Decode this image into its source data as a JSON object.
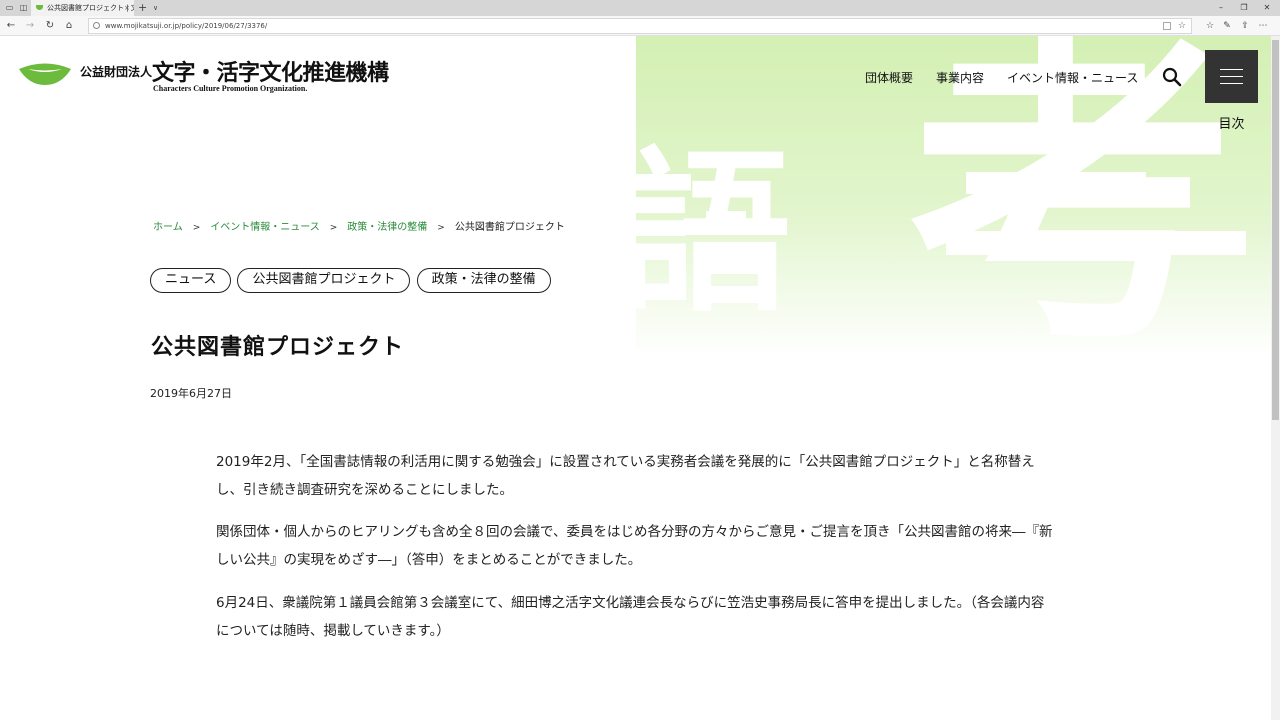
{
  "browser": {
    "tab_title": "公共図書館プロジェクト | 文",
    "tab_close": "×",
    "new_tab": "+",
    "tab_list": "∨",
    "url": "www.mojikatsuji.or.jp/policy/2019/06/27/3376/",
    "icons": [
      "tab-actions-icon",
      "back-icon",
      "forward-icon",
      "refresh-icon",
      "home-icon",
      "favorite-star-icon",
      "favorites-icon",
      "pen-icon",
      "share-icon",
      "more-icon"
    ]
  },
  "site": {
    "logo_prefix": "公益財団法人",
    "logo_title": "文字・活字文化推進機構",
    "logo_subtitle": "Characters Culture Promotion Organization.",
    "brand_color": "#6cbb3c"
  },
  "nav": {
    "items": [
      "団体概要",
      "事業内容",
      "イベント情報・ニュース"
    ],
    "menu_label": "目次"
  },
  "hero": {
    "glyph_left": "語",
    "glyph_right": "考"
  },
  "breadcrumb": {
    "items": [
      "ホーム",
      "イベント情報・ニュース",
      "政策・法律の整備"
    ],
    "current": "公共図書館プロジェクト",
    "link_color": "#2a8c3a"
  },
  "tags": [
    "ニュース",
    "公共図書館プロジェクト",
    "政策・法律の整備"
  ],
  "article": {
    "title": "公共図書館プロジェクト",
    "date": "2019年6月27日",
    "paragraphs": [
      "2019年2月、「全国書誌情報の利活用に関する勉強会」に設置されている実務者会議を発展的に「公共図書館プロジェクト」と名称替えし、引き続き調査研究を深めることにしました。",
      "関係団体・個人からのヒアリングも含め全８回の会議で、委員をはじめ各分野の方々からご意見・ご提言を頂き「公共図書館の将来―『新しい公共』の実現をめざす―」（答申）をまとめることができました。",
      "6月24日、衆議院第１議員会館第３会議室にて、細田博之活字文化議連会長ならびに笠浩史事務局長に答申を提出しました。（各会議内容については随時、掲載していきます。）"
    ]
  }
}
